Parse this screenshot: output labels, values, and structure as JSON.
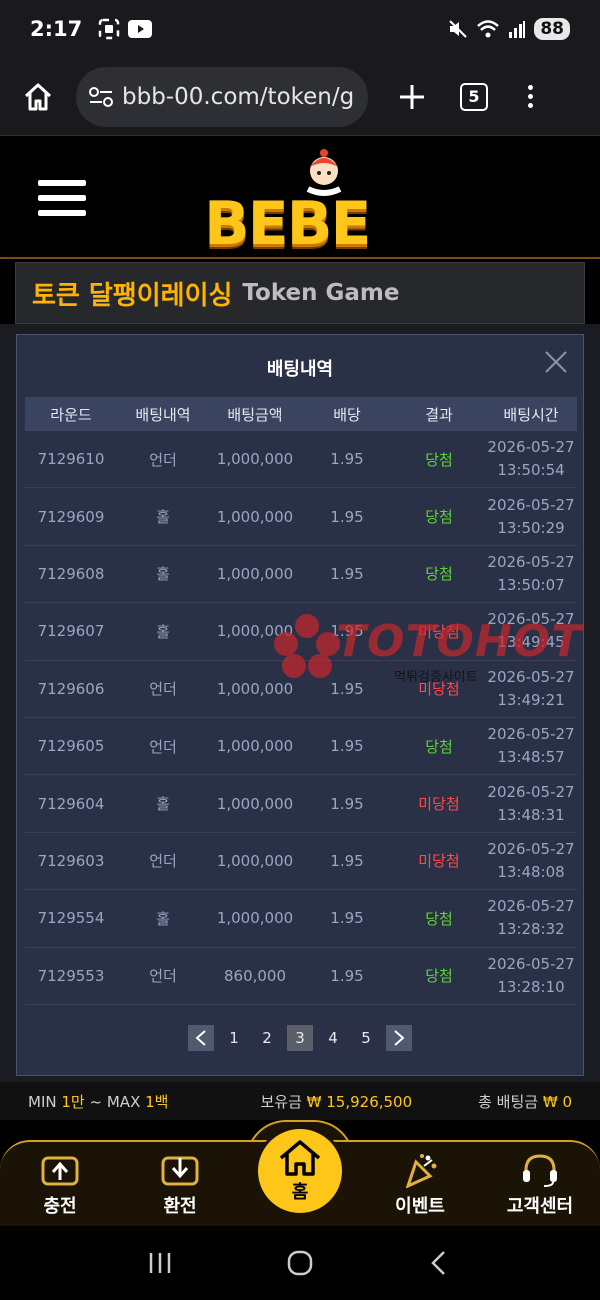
{
  "status_bar": {
    "time": "2:17",
    "battery": "88"
  },
  "browser": {
    "url": "bbb-00.com/token/g",
    "tab_count": "5"
  },
  "site": {
    "logo_text": "BEBE"
  },
  "page_title": {
    "ko": "토큰 달팽이레이싱",
    "en": "Token Game"
  },
  "modal": {
    "title": "배팅내역",
    "headers": [
      "라운드",
      "배팅내역",
      "배팅금액",
      "배당",
      "결과",
      "배팅시간"
    ],
    "rows": [
      {
        "round": "7129610",
        "bet": "언더",
        "amount": "1,000,000",
        "odds": "1.95",
        "result": "당첨",
        "date": "2026-05-27",
        "time": "13:50:54"
      },
      {
        "round": "7129609",
        "bet": "홀",
        "amount": "1,000,000",
        "odds": "1.95",
        "result": "당첨",
        "date": "2026-05-27",
        "time": "13:50:29"
      },
      {
        "round": "7129608",
        "bet": "홀",
        "amount": "1,000,000",
        "odds": "1.95",
        "result": "당첨",
        "date": "2026-05-27",
        "time": "13:50:07"
      },
      {
        "round": "7129607",
        "bet": "홀",
        "amount": "1,000,000",
        "odds": "1.95",
        "result": "미당첨",
        "date": "2026-05-27",
        "time": "13:49:45"
      },
      {
        "round": "7129606",
        "bet": "언더",
        "amount": "1,000,000",
        "odds": "1.95",
        "result": "미당첨",
        "date": "2026-05-27",
        "time": "13:49:21"
      },
      {
        "round": "7129605",
        "bet": "언더",
        "amount": "1,000,000",
        "odds": "1.95",
        "result": "당첨",
        "date": "2026-05-27",
        "time": "13:48:57"
      },
      {
        "round": "7129604",
        "bet": "홀",
        "amount": "1,000,000",
        "odds": "1.95",
        "result": "미당첨",
        "date": "2026-05-27",
        "time": "13:48:31"
      },
      {
        "round": "7129603",
        "bet": "언더",
        "amount": "1,000,000",
        "odds": "1.95",
        "result": "미당첨",
        "date": "2026-05-27",
        "time": "13:48:08"
      },
      {
        "round": "7129554",
        "bet": "홀",
        "amount": "1,000,000",
        "odds": "1.95",
        "result": "당첨",
        "date": "2026-05-27",
        "time": "13:28:32"
      },
      {
        "round": "7129553",
        "bet": "언더",
        "amount": "860,000",
        "odds": "1.95",
        "result": "당첨",
        "date": "2026-05-27",
        "time": "13:28:10"
      }
    ],
    "pages": [
      "1",
      "2",
      "3",
      "4",
      "5"
    ],
    "active_page": "3"
  },
  "watermark": {
    "brand": "TOTOHOT",
    "sub": "먹튀검증사이트"
  },
  "stats": {
    "min_label": "MIN",
    "min_value": "1만",
    "sep": "~",
    "max_label": "MAX",
    "max_value": "1백",
    "balance_label": "보유금",
    "balance_value": "₩ 15,926,500",
    "total_bet_label": "총 배팅금",
    "total_bet_value": "₩ 0"
  },
  "bottom_nav": {
    "charge": "충전",
    "withdraw": "환전",
    "home": "홈",
    "event": "이벤트",
    "support": "고객센터"
  },
  "colors": {
    "accent": "#ffc61a",
    "win": "#5fd33a",
    "lose": "#ff4a4a",
    "modal_bg": "#2a3045"
  }
}
